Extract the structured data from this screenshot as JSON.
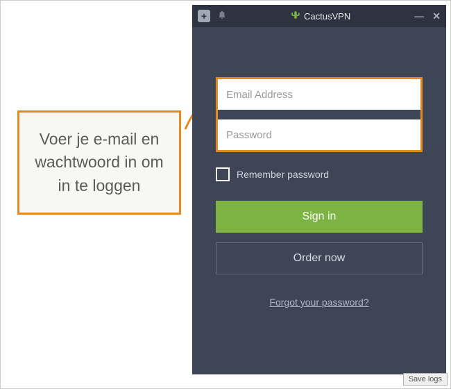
{
  "app": {
    "title": "CactusVPN"
  },
  "login": {
    "email_placeholder": "Email Address",
    "password_placeholder": "Password",
    "remember_label": "Remember password",
    "signin_label": "Sign in",
    "order_label": "Order now",
    "forgot_label": "Forgot your password?"
  },
  "footer": {
    "save_logs": "Save logs"
  },
  "callout": {
    "text": "Voer je e-mail en wachtwoord in om in te loggen"
  },
  "colors": {
    "accent": "#e28a1e",
    "primary": "#7cb342",
    "bg_dark": "#3d4556"
  }
}
